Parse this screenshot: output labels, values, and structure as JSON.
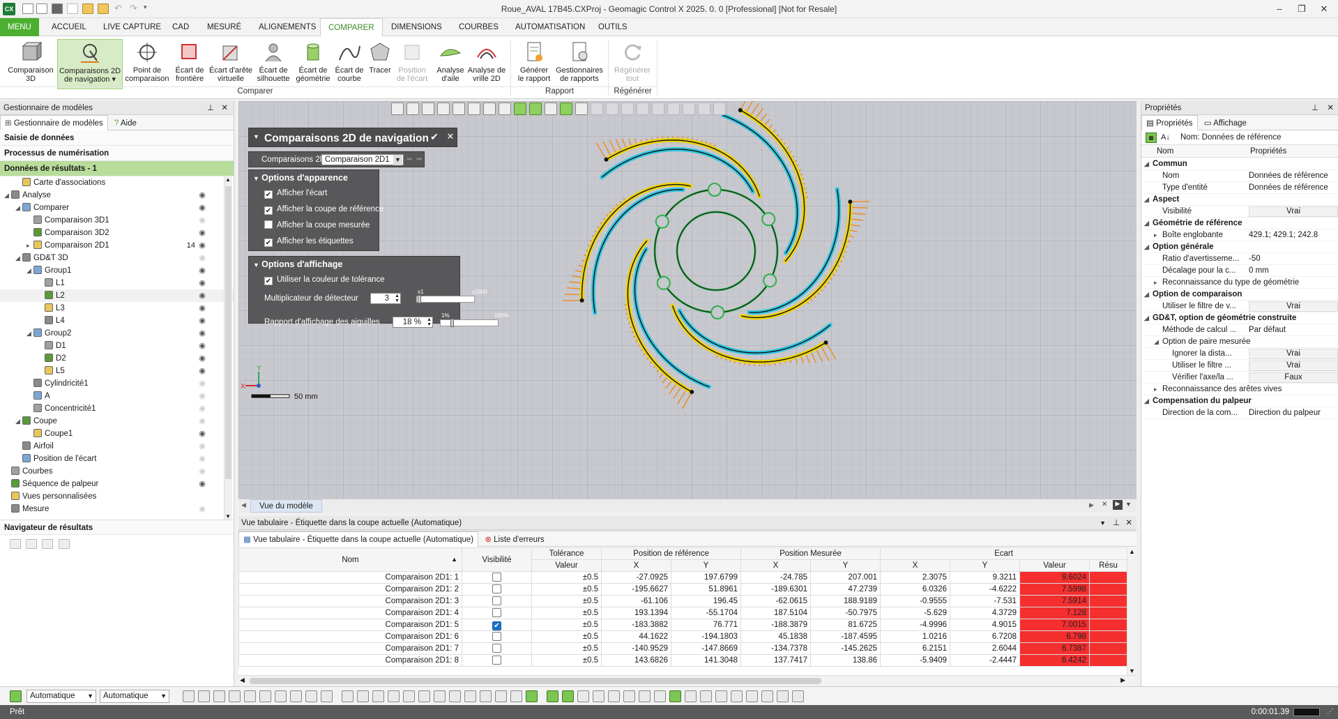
{
  "app": {
    "title": "Roue_AVAL  17B45.CXProj - Geomagic Control X 2025. 0. 0 [Professional] [Not for Resale]",
    "icon_label": "CX"
  },
  "ribbon_tabs": [
    "MENU",
    "ACCUEIL",
    "LIVE CAPTURE",
    "CAD",
    "MESURÉ",
    "ALIGNEMENTS",
    "COMPARER",
    "DIMENSIONS",
    "COURBES",
    "AUTOMATISATION",
    "OUTILS"
  ],
  "ribbon": {
    "buttons": [
      {
        "l1": "Comparaison",
        "l2": "3D"
      },
      {
        "l1": "Comparaisons 2D",
        "l2": "de navigation ▾"
      },
      {
        "l1": "Point de",
        "l2": "comparaison"
      },
      {
        "l1": "Écart de",
        "l2": "frontière"
      },
      {
        "l1": "Écart d'arête",
        "l2": "virtuelle"
      },
      {
        "l1": "Écart de",
        "l2": "silhouette"
      },
      {
        "l1": "Écart de",
        "l2": "géométrie"
      },
      {
        "l1": "Écart de",
        "l2": "courbe"
      },
      {
        "l1": "Tracer",
        "l2": ""
      },
      {
        "l1": "Position",
        "l2": "de l'écart"
      },
      {
        "l1": "Analyse",
        "l2": "d'aile"
      },
      {
        "l1": "Analyse de",
        "l2": "vrille 2D"
      },
      {
        "l1": "Générer",
        "l2": "le rapport"
      },
      {
        "l1": "Gestionnaires",
        "l2": "de rapports"
      },
      {
        "l1": "Régénérer",
        "l2": "tout"
      }
    ],
    "groups": [
      "Comparer",
      "Rapport",
      "Régénérer"
    ]
  },
  "left_panel": {
    "title": "Gestionnaire de modèles",
    "tabs": [
      "Gestionnaire de modèles",
      "Aide"
    ],
    "sections": [
      "Saisie de données",
      "Processus de numérisation",
      "Données de résultats - 1"
    ],
    "tree": [
      {
        "label": "Carte d'associations",
        "indent": 1,
        "tri": "",
        "eye": "none"
      },
      {
        "label": "Analyse",
        "indent": 0,
        "tri": "◢",
        "eye": "on"
      },
      {
        "label": "Comparer",
        "indent": 1,
        "tri": "◢",
        "eye": "on"
      },
      {
        "label": "Comparaison 3D1",
        "indent": 2,
        "tri": "",
        "eye": "off"
      },
      {
        "label": "Comparaison 3D2",
        "indent": 2,
        "tri": "",
        "eye": "on"
      },
      {
        "label": "Comparaison 2D1",
        "indent": 2,
        "tri": "▸",
        "eye": "on",
        "count": "14"
      },
      {
        "label": "GD&T 3D",
        "indent": 1,
        "tri": "◢",
        "eye": "off"
      },
      {
        "label": "Group1",
        "indent": 2,
        "tri": "◢",
        "eye": "on"
      },
      {
        "label": "L1",
        "indent": 3,
        "tri": "",
        "eye": "on"
      },
      {
        "label": "L2",
        "indent": 3,
        "tri": "",
        "eye": "on"
      },
      {
        "label": "L3",
        "indent": 3,
        "tri": "",
        "eye": "on"
      },
      {
        "label": "L4",
        "indent": 3,
        "tri": "",
        "eye": "on"
      },
      {
        "label": "Group2",
        "indent": 2,
        "tri": "◢",
        "eye": "on"
      },
      {
        "label": "D1",
        "indent": 3,
        "tri": "",
        "eye": "on"
      },
      {
        "label": "D2",
        "indent": 3,
        "tri": "",
        "eye": "on"
      },
      {
        "label": "L5",
        "indent": 3,
        "tri": "",
        "eye": "on"
      },
      {
        "label": "Cylindricité1",
        "indent": 2,
        "tri": "",
        "eye": "off"
      },
      {
        "label": "A",
        "indent": 2,
        "tri": "",
        "eye": "off"
      },
      {
        "label": "Concentricité1",
        "indent": 2,
        "tri": "",
        "eye": "off"
      },
      {
        "label": "Coupe",
        "indent": 1,
        "tri": "◢",
        "eye": "off"
      },
      {
        "label": "Coupe1",
        "indent": 2,
        "tri": "",
        "eye": "on"
      },
      {
        "label": "Airfoil",
        "indent": 1,
        "tri": "",
        "eye": "off"
      },
      {
        "label": "Position de l'écart",
        "indent": 1,
        "tri": "",
        "eye": "off"
      },
      {
        "label": "Courbes",
        "indent": 0,
        "tri": "",
        "eye": "off"
      },
      {
        "label": "Séquence de palpeur",
        "indent": 0,
        "tri": "",
        "eye": "on"
      },
      {
        "label": "Vues personnalisées",
        "indent": 0,
        "tri": "",
        "eye": "none"
      },
      {
        "label": "Mesure",
        "indent": 0,
        "tri": "",
        "eye": "off"
      }
    ],
    "navigator": "Navigateur de résultats"
  },
  "dialog": {
    "title": "Comparaisons 2D de navigation",
    "selector_label": "Comparaisons 2D",
    "selector_value": "Comparaison 2D1",
    "appearance": {
      "title": "Options d'apparence",
      "items": [
        {
          "label": "Afficher l'écart",
          "checked": true
        },
        {
          "label": "Afficher la coupe de référence",
          "checked": true
        },
        {
          "label": "Afficher la coupe mesurée",
          "checked": false
        },
        {
          "label": "Afficher les étiquettes",
          "checked": true
        }
      ]
    },
    "display": {
      "title": "Options d'affichage",
      "tolerance_color": "Utiliser la couleur de tolérance",
      "multiplier_label": "Multiplicateur de détecteur",
      "multiplier_value": "3",
      "multiplier_min": "x1",
      "multiplier_max": "x1000",
      "needle_label": "Rapport d'affichage des aiguilles",
      "needle_value": "18 %",
      "needle_min": "1%",
      "needle_max": "100%"
    }
  },
  "viewport": {
    "scale_label": "50 mm",
    "tab": "Vue du modèle"
  },
  "right_panel": {
    "title": "Propriétés",
    "tabs": [
      "Propriétés",
      "Affichage"
    ],
    "name_line": "Nom: Données de référence",
    "col_name": "Nom",
    "col_prop": "Propriétés",
    "rows": [
      {
        "k": "Commun",
        "cat": true,
        "lvl": 0
      },
      {
        "k": "Nom",
        "v": "Données de référence",
        "lvl": 1
      },
      {
        "k": "Type d'entité",
        "v": "Données de référence",
        "lvl": 1
      },
      {
        "k": "Aspect",
        "cat": true,
        "lvl": 0
      },
      {
        "k": "Visibilité",
        "v": "Vrai",
        "lvl": 1,
        "box": true
      },
      {
        "k": "Géométrie de référence",
        "cat": true,
        "lvl": 0
      },
      {
        "k": "Boîte englobante",
        "v": "429.1; 429.1; 242.8",
        "lvl": 1,
        "tri": true
      },
      {
        "k": "Option générale",
        "cat": true,
        "lvl": 0
      },
      {
        "k": "Ratio d'avertisseme...",
        "v": "-50",
        "lvl": 1
      },
      {
        "k": "Décalage pour la c...",
        "v": "0 mm",
        "lvl": 1
      },
      {
        "k": "Reconnaissance du type de géométrie",
        "v": "",
        "lvl": 1,
        "tri": true
      },
      {
        "k": "Option de comparaison",
        "cat": true,
        "lvl": 0
      },
      {
        "k": "Utiliser le filtre de v...",
        "v": "Vrai",
        "lvl": 1,
        "box": true
      },
      {
        "k": "GD&T, option de géométrie construite",
        "cat": true,
        "lvl": 0
      },
      {
        "k": "Méthode de calcul ...",
        "v": "Par défaut",
        "lvl": 1
      },
      {
        "k": "Option de paire mesurée",
        "v": "",
        "lvl": 1,
        "tri": true,
        "open": true
      },
      {
        "k": "Ignorer la dista...",
        "v": "Vrai",
        "lvl": 2,
        "box": true
      },
      {
        "k": "Utiliser le filtre ...",
        "v": "Vrai",
        "lvl": 2,
        "box": true
      },
      {
        "k": "Vérifier l'axe/la ...",
        "v": "Faux",
        "lvl": 2,
        "box": true
      },
      {
        "k": "Reconnaissance des arêtes vives",
        "v": "",
        "lvl": 1,
        "tri": true
      },
      {
        "k": "Compensation du palpeur",
        "cat": true,
        "lvl": 0
      },
      {
        "k": "Direction de la com...",
        "v": "Direction du palpeur",
        "lvl": 1
      }
    ]
  },
  "bottom": {
    "title": "Vue tabulaire - Étiquette dans la coupe actuelle (Automatique)",
    "tab1": "Vue tabulaire - Étiquette dans la coupe actuelle (Automatique)",
    "tab2": "Liste d'erreurs",
    "headers": {
      "nom": "Nom",
      "visibilite": "Visibilité",
      "tolerance": "Tolérance",
      "valeur": "Valeur",
      "posref": "Position de référence",
      "posmes": "Position Mesurée",
      "ecart": "Ecart",
      "x": "X",
      "y": "Y",
      "val": "Valeur",
      "resu": "Résu"
    },
    "rows": [
      {
        "nom": "Comparaison 2D1: 1",
        "vis": false,
        "tol": "±0.5",
        "rx": "-27.0925",
        "ry": "197.6799",
        "mx": "-24.785",
        "my": "207.001",
        "ex": "2.3075",
        "ey": "9.3211",
        "v": "9.6024"
      },
      {
        "nom": "Comparaison 2D1: 2",
        "vis": false,
        "tol": "±0.5",
        "rx": "-195.6627",
        "ry": "51.8961",
        "mx": "-189.6301",
        "my": "47.2739",
        "ex": "6.0326",
        "ey": "-4.6222",
        "v": "7.5998"
      },
      {
        "nom": "Comparaison 2D1: 3",
        "vis": false,
        "tol": "±0.5",
        "rx": "-61.106",
        "ry": "196.45",
        "mx": "-62.0615",
        "my": "188.9189",
        "ex": "-0.9555",
        "ey": "-7.531",
        "v": "7.5914"
      },
      {
        "nom": "Comparaison 2D1: 4",
        "vis": false,
        "tol": "±0.5",
        "rx": "193.1394",
        "ry": "-55.1704",
        "mx": "187.5104",
        "my": "-50.7975",
        "ex": "-5.629",
        "ey": "4.3729",
        "v": "7.128"
      },
      {
        "nom": "Comparaison 2D1: 5",
        "vis": true,
        "tol": "±0.5",
        "rx": "-183.3882",
        "ry": "76.771",
        "mx": "-188.3879",
        "my": "81.6725",
        "ex": "-4.9996",
        "ey": "4.9015",
        "v": "7.0015"
      },
      {
        "nom": "Comparaison 2D1: 6",
        "vis": false,
        "tol": "±0.5",
        "rx": "44.1622",
        "ry": "-194.1803",
        "mx": "45.1838",
        "my": "-187.4595",
        "ex": "1.0216",
        "ey": "6.7208",
        "v": "6.798"
      },
      {
        "nom": "Comparaison 2D1: 7",
        "vis": false,
        "tol": "±0.5",
        "rx": "-140.9529",
        "ry": "-147.8669",
        "mx": "-134.7378",
        "my": "-145.2625",
        "ex": "6.2151",
        "ey": "2.6044",
        "v": "6.7387"
      },
      {
        "nom": "Comparaison 2D1: 8",
        "vis": false,
        "tol": "±0.5",
        "rx": "143.6826",
        "ry": "141.3048",
        "mx": "137.7417",
        "my": "138.86",
        "ex": "-5.9409",
        "ey": "-2.4447",
        "v": "6.4242"
      }
    ]
  },
  "bottom_bar": {
    "combo1": "Automatique",
    "combo2": "Automatique"
  },
  "status": {
    "left": "Prêt",
    "time": "0:00:01.39"
  },
  "colors": {
    "accent": "#4caf30",
    "tolerance_red": "#f52e2e",
    "ref_blue": "#2fc6e0",
    "meas_yellow": "#f0d400",
    "dev_orange": "#f08a1a"
  }
}
